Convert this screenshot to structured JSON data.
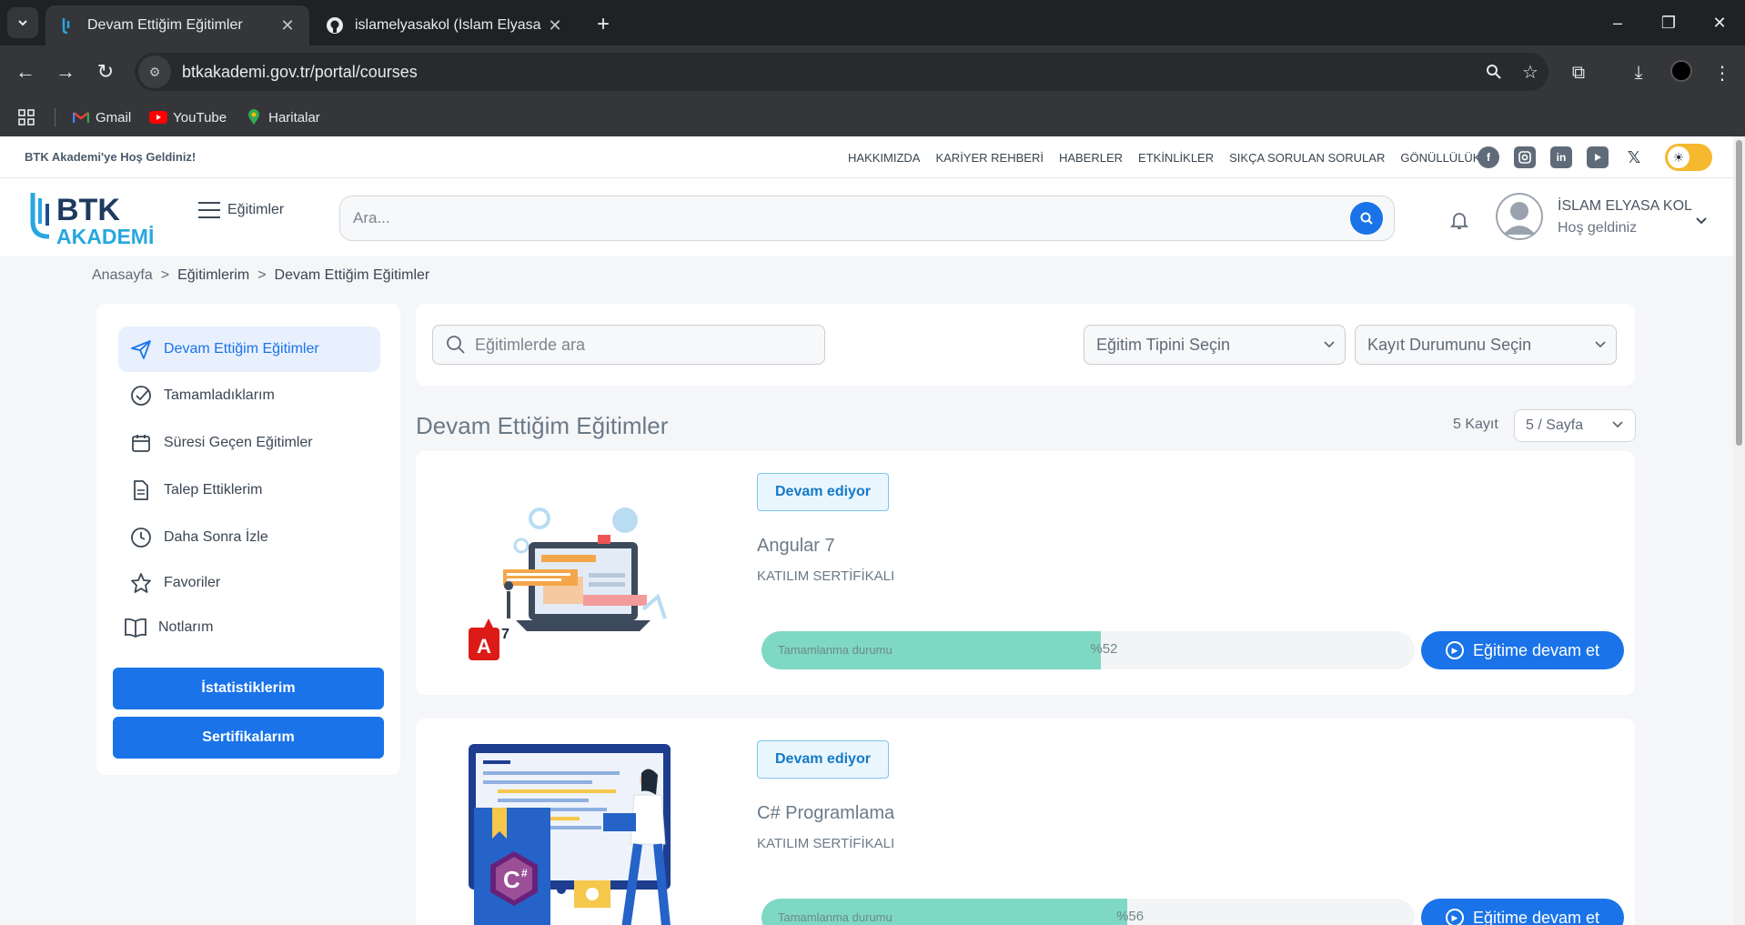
{
  "browser": {
    "tabs": [
      {
        "title": "Devam Ettiğim Eğitimler",
        "active": true
      },
      {
        "title": "islamelyasakol (İslam Elyasa Kol)",
        "active": false
      }
    ],
    "url": "btkakademi.gov.tr/portal/courses",
    "bookmarks": [
      {
        "label": "Gmail",
        "icon": "gmail-icon"
      },
      {
        "label": "YouTube",
        "icon": "youtube-icon"
      },
      {
        "label": "Haritalar",
        "icon": "maps-icon"
      }
    ]
  },
  "site": {
    "welcome": "BTK Akademi'ye Hoş Geldiniz!",
    "topnav": [
      "HAKKIMIZDA",
      "KARİYER REHBERİ",
      "HABERLER",
      "ETKİNLİKLER",
      "SIKÇA SORULAN SORULAR",
      "GÖNÜLLÜLÜK"
    ],
    "social": [
      "facebook-icon",
      "instagram-icon",
      "linkedin-icon",
      "youtube-icon",
      "x-icon"
    ],
    "logo_top": "BTK",
    "logo_bottom": "AKADEMİ",
    "menu_label": "Eğitimler",
    "search_placeholder": "Ara...",
    "user_name": "İSLAM ELYASA KOL",
    "user_greeting": "Hoş geldiniz"
  },
  "breadcrumb": [
    "Anasayfa",
    "Eğitimlerim",
    "Devam Ettiğim Eğitimler"
  ],
  "sidebar": {
    "items": [
      {
        "label": "Devam Ettiğim Eğitimler",
        "icon": "send-icon",
        "active": true
      },
      {
        "label": "Tamamladıklarım",
        "icon": "check-circle-icon"
      },
      {
        "label": "Süresi Geçen Eğitimler",
        "icon": "calendar-icon"
      },
      {
        "label": "Talep Ettiklerim",
        "icon": "document-icon"
      },
      {
        "label": "Daha Sonra İzle",
        "icon": "clock-icon"
      },
      {
        "label": "Favoriler",
        "icon": "star-icon"
      },
      {
        "label": "Notlarım",
        "icon": "book-icon"
      }
    ],
    "buttons": [
      "İstatistiklerim",
      "Sertifikalarım"
    ]
  },
  "filters": {
    "search_placeholder": "Eğitimlerde ara",
    "type_select": "Eğitim Tipini Seçin",
    "status_select": "Kayıt Durumunu Seçin"
  },
  "list": {
    "title": "Devam Ettiğim Eğitimler",
    "count": "5 Kayıt",
    "per_page": "5 / Sayfa"
  },
  "courses": [
    {
      "status": "Devam ediyor",
      "title": "Angular 7",
      "certificate": "KATILIM SERTİFİKALI",
      "progress_label": "Tamamlanma durumu",
      "progress_text": "%52",
      "progress": 0.52,
      "button": "Eğitime devam et"
    },
    {
      "status": "Devam ediyor",
      "title": "C# Programlama",
      "certificate": "KATILIM SERTİFİKALI",
      "progress_label": "Tamamlanma durumu",
      "progress_text": "%56",
      "progress": 0.56,
      "button": "Eğitime devam et"
    }
  ],
  "colors": {
    "primary": "#1a73e8",
    "progress_fill": "#7ed8c4",
    "badge_text": "#1579c6",
    "chrome_dark": "#202124"
  }
}
